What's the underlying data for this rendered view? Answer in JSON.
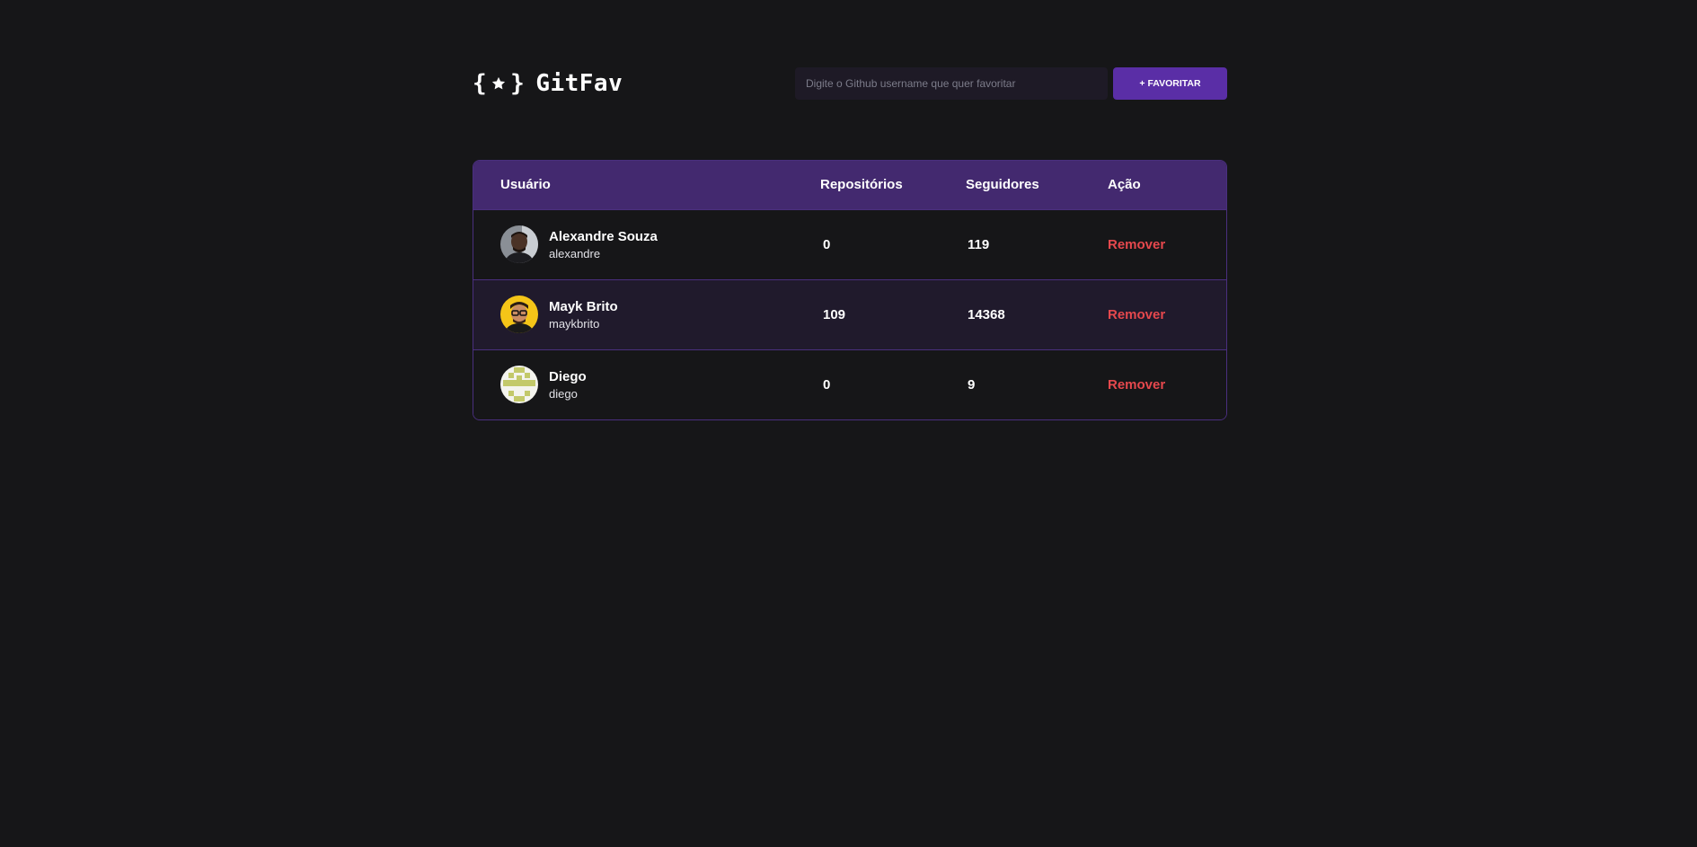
{
  "header": {
    "logo_text": "GitFav",
    "logo_left_brace": "{",
    "logo_right_brace": "}",
    "logo_icon": "star-icon"
  },
  "search": {
    "placeholder": "Digite o Github username que quer favoritar",
    "value": "",
    "button_label": "+ Favoritar"
  },
  "table": {
    "columns": [
      "Usuário",
      "Repositórios",
      "Seguidores",
      "Ação"
    ],
    "rows": [
      {
        "name": "Alexandre Souza",
        "login": "alexandre",
        "repos": "0",
        "followers": "119",
        "action": "Remover"
      },
      {
        "name": "Mayk Brito",
        "login": "maykbrito",
        "repos": "109",
        "followers": "14368",
        "action": "Remover"
      },
      {
        "name": "Diego",
        "login": "diego",
        "repos": "0",
        "followers": "9",
        "action": "Remover"
      }
    ]
  },
  "colors": {
    "background": "#161618",
    "accent": "#5a2ea6",
    "header_row": "#43296f",
    "remove": "#e5484d"
  }
}
